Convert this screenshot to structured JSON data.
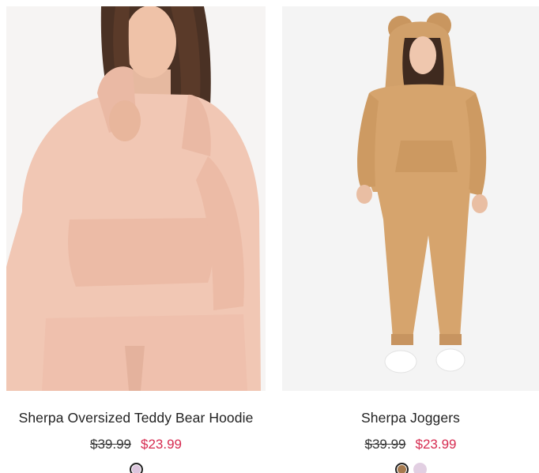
{
  "products": [
    {
      "name": "Sherpa Oversized Teddy Bear Hoodie",
      "original_price": "$39.99",
      "sale_price": "$23.99",
      "swatches": [
        {
          "color": "#dcc5dd",
          "selected": true
        }
      ]
    },
    {
      "name": "Sherpa Joggers",
      "original_price": "$39.99",
      "sale_price": "$23.99",
      "swatches": [
        {
          "color": "#a67a4f",
          "selected": true
        },
        {
          "color": "#e2cfe2",
          "selected": false
        }
      ]
    }
  ],
  "colors": {
    "sale_price": "#d62b50",
    "hoodie_pink": "#f1c7b4",
    "jogger_tan": "#d6a46d"
  }
}
